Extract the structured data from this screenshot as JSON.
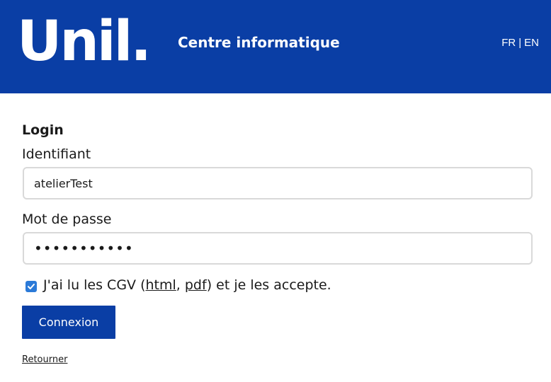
{
  "header": {
    "logo_text": "Unil.",
    "title": "Centre informatique",
    "lang": {
      "fr": "FR",
      "separator": "|",
      "en": "EN"
    },
    "bg_color": "#0a3ea5"
  },
  "form": {
    "section_title": "Login",
    "username_label": "Identifiant",
    "username_value": "atelierTest",
    "password_label": "Mot de passe",
    "password_value": "•••••••••••",
    "cgv": {
      "checked": true,
      "prefix": "J'ai lu les CGV (",
      "html_link": "html",
      "comma": ",",
      "pdf_link": "pdf",
      "suffix": ") et je les accepte."
    },
    "submit_label": "Connexion",
    "back_label": "Retourner"
  }
}
